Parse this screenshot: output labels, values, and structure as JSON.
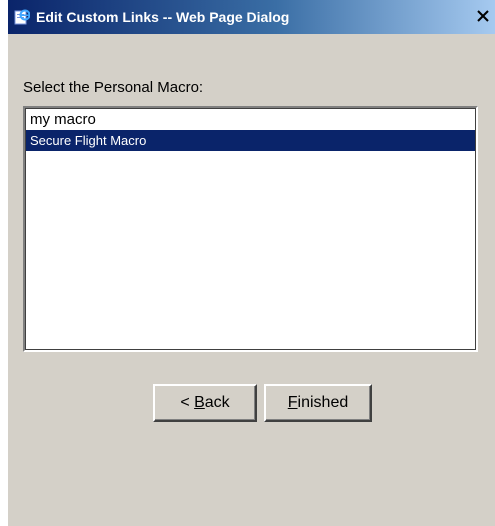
{
  "window": {
    "title": "Edit Custom Links -- Web Page Dialog",
    "close_glyph": "×",
    "icon": "ie-page-icon"
  },
  "dialog": {
    "prompt": "Select the Personal Macro:",
    "macros": [
      {
        "label": "my  macro",
        "selected": false
      },
      {
        "label": "Secure Flight Macro",
        "selected": true
      }
    ]
  },
  "buttons": {
    "back_label": "< Back",
    "finished_label": "Finished"
  },
  "colors": {
    "titlebar_start": "#0a246a",
    "titlebar_end": "#a6caf0",
    "dialog_face": "#d4d0c8",
    "selection": "#0a246a"
  }
}
